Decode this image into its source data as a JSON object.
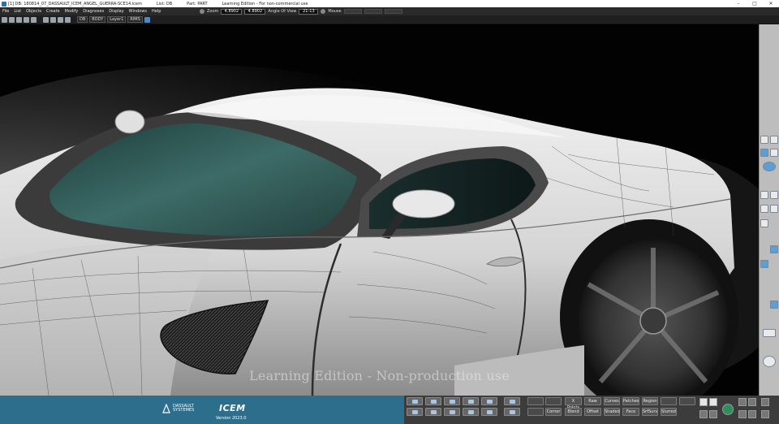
{
  "title_bar": {
    "file_name": "[1] DB: 180814_07_DASSAULT_ICEM_ANGEL_GUERRA-SCE14.icem",
    "list": "List: DB",
    "part": "Part: PART",
    "edition": "Learning Edition - For non-commercial use",
    "minimize": "–",
    "maximize": "□",
    "close": "✕"
  },
  "menu": [
    "File",
    "List",
    "Objects",
    "Create",
    "Modify",
    "Diagnoses",
    "Display",
    "Windows",
    "Help"
  ],
  "view_controls": {
    "zoom_label": "Zoom",
    "zoom_value": "4.8902",
    "zoom_value_2": "4.8902",
    "angle_label": "Angle Of View",
    "angle_value": "21-13",
    "mouse_label": "Mouse"
  },
  "toolbar": {
    "layers": [
      "DB",
      "BODY",
      "Layer1",
      "RIMS"
    ]
  },
  "viewport": {
    "watermark": "Learning Edition - Non-production use",
    "glass_color": "#2f5a57",
    "body_color": "#d9d9d9"
  },
  "branding": {
    "company_line1": "DASSAULT",
    "company_line2": "SYSTEMES",
    "product": "ICEM",
    "version": "Version 2023.0",
    "bar_color": "#2e6e8d"
  },
  "bottom_buttons": {
    "row1": [
      "X Points",
      "Raw",
      "Curves",
      "Patches",
      "Region"
    ],
    "row2": [
      "Corner",
      "Blend",
      "Offset",
      "Shaded",
      "Face",
      "SrfSurv",
      "Slurred"
    ]
  },
  "icons": {
    "toolbar": [
      "new-file-icon",
      "open-icon",
      "save-icon",
      "print-icon",
      "undo-icon",
      "redo-icon",
      "cut-icon",
      "copy-icon",
      "paste-icon",
      "render-icon"
    ],
    "right_palette": [
      "view-top-icon",
      "view-front-icon",
      "shade-icon",
      "light-icon",
      "sphere-icon",
      "grid-icon",
      "layers-icon",
      "snap-icon",
      "measure-icon",
      "axis-icon",
      "section-icon",
      "mirror-icon",
      "probe-icon",
      "camera-icon",
      "settings-icon"
    ],
    "bottom_tools": [
      "select-icon",
      "rotate-icon",
      "pan-icon",
      "zoom-icon",
      "fit-icon",
      "pick-icon",
      "points-icon",
      "curve-icon",
      "surface-icon",
      "network-icon"
    ]
  }
}
